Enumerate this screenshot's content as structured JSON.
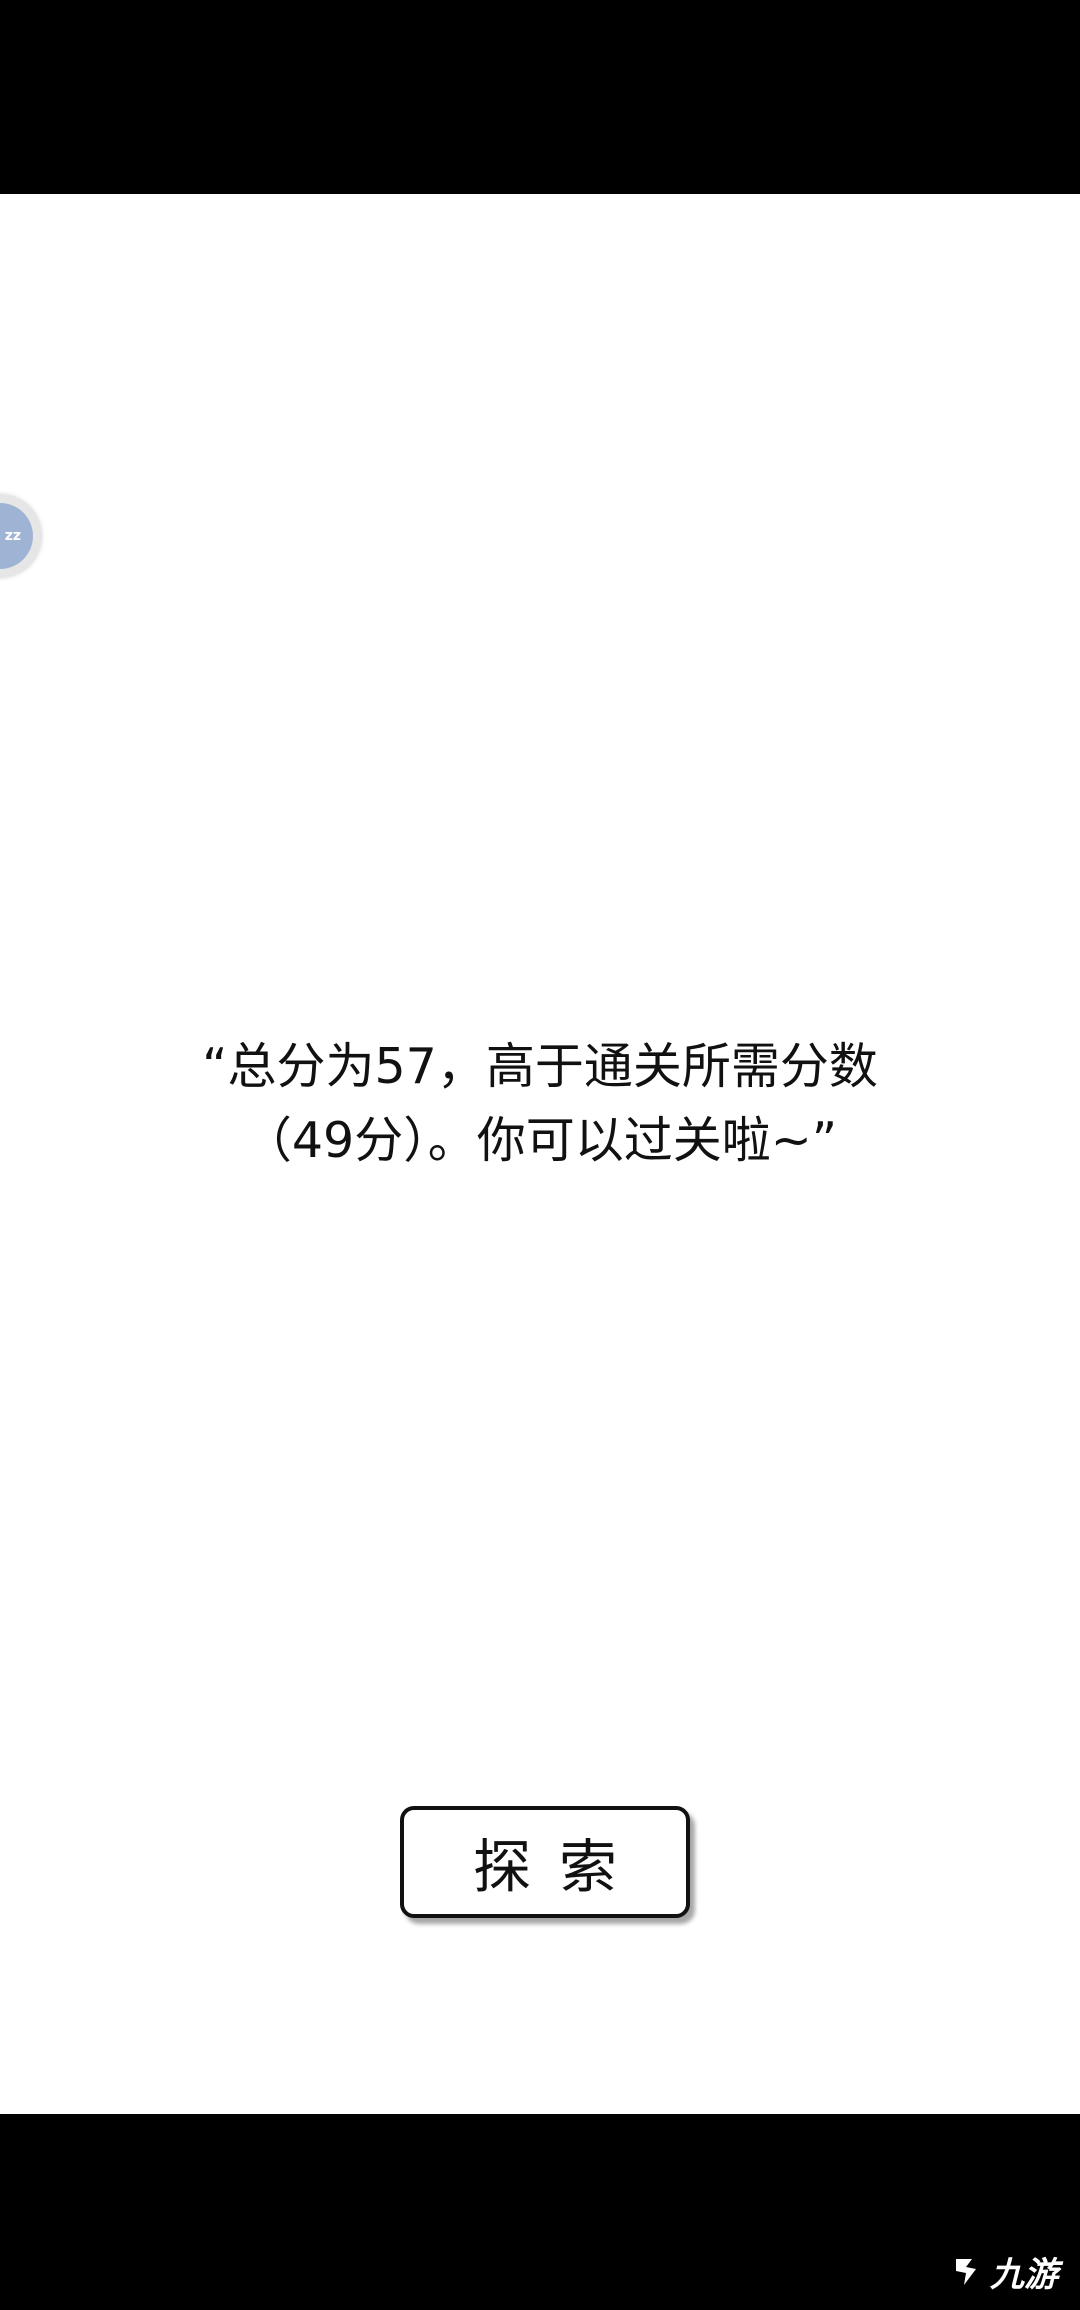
{
  "float_ball": {
    "label": "zz",
    "icon": "assistive-ball-icon"
  },
  "dialogue": {
    "line1": "“总分为57，高于通关所需分数",
    "line2": "（49分）。你可以过关啦~”"
  },
  "actions": {
    "explore_label": "探索"
  },
  "watermark": {
    "text": "九游"
  },
  "colors": {
    "background": "#ffffff",
    "bars": "#000000",
    "text": "#111111",
    "ball_accent": "#9fb4d4"
  }
}
